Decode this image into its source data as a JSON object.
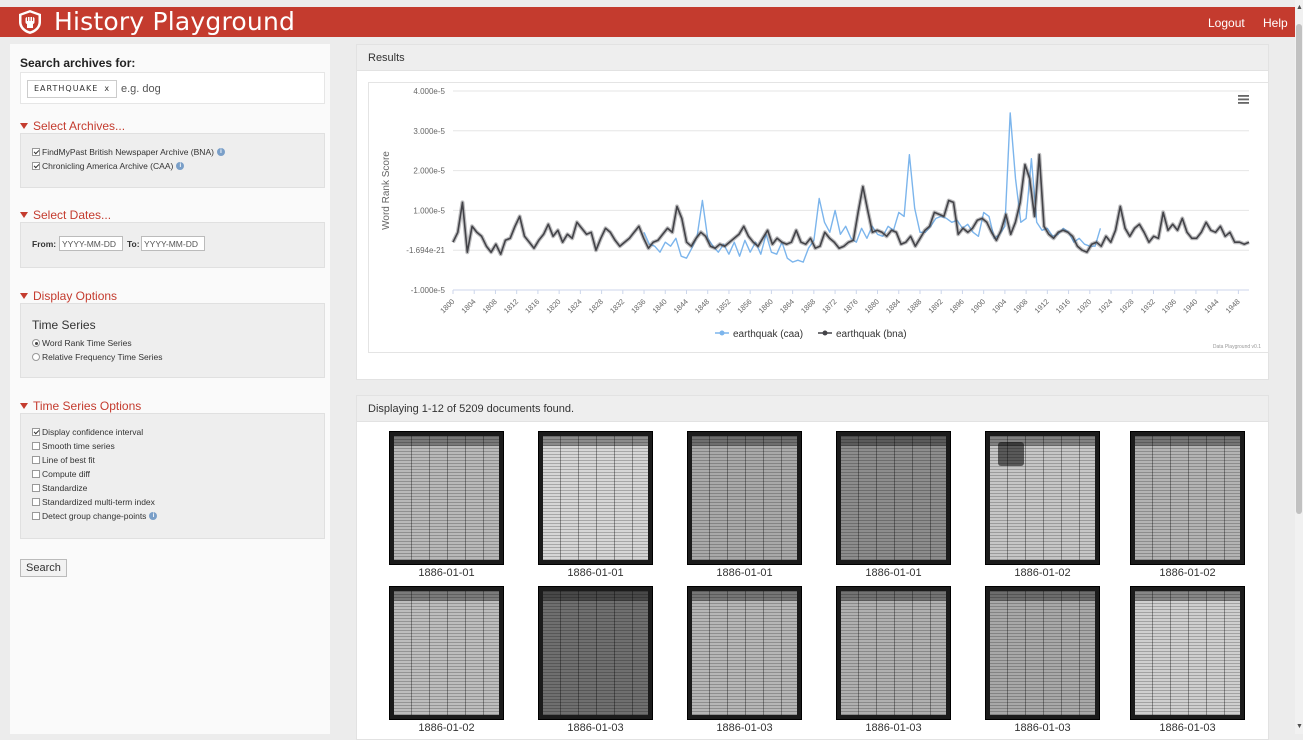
{
  "header": {
    "title": "History Playground",
    "logout_label": "Logout",
    "help_label": "Help",
    "brand_color": "#c43b2e",
    "logo_icon": "fist-shield-icon"
  },
  "sidebar": {
    "search_label": "Search archives for:",
    "search_term": "EARTHQUAKE",
    "search_term_remove": "x",
    "search_placeholder": "e.g. dog",
    "archives": {
      "title": "Select Archives...",
      "items": [
        {
          "label": "FindMyPast British Newspaper Archive (BNA)",
          "checked": true,
          "info_icon": "info-icon"
        },
        {
          "label": "Chronicling America Archive (CAA)",
          "checked": true,
          "info_icon": "info-icon"
        }
      ]
    },
    "dates": {
      "title": "Select Dates...",
      "from_label": "From:",
      "from_placeholder": "YYYY-MM-DD",
      "to_label": "To:",
      "to_placeholder": "YYYY-MM-DD"
    },
    "display": {
      "title": "Display Options",
      "subheading": "Time Series",
      "options": [
        {
          "label": "Word Rank Time Series",
          "selected": true
        },
        {
          "label": "Relative Frequency Time Series",
          "selected": false
        }
      ]
    },
    "ts_options": {
      "title": "Time Series Options",
      "items": [
        {
          "label": "Display confidence interval",
          "checked": true
        },
        {
          "label": "Smooth time series",
          "checked": false
        },
        {
          "label": "Line of best fit",
          "checked": false
        },
        {
          "label": "Compute diff",
          "checked": false
        },
        {
          "label": "Standardize",
          "checked": false
        },
        {
          "label": "Standardized multi-term index",
          "checked": false
        },
        {
          "label": "Detect group change-points",
          "checked": false,
          "info_icon": "info-icon"
        }
      ]
    },
    "search_button": "Search"
  },
  "results": {
    "title": "Results",
    "credit": "Data Playground v0.1",
    "menu_icon": "hamburger-menu-icon"
  },
  "chart_data": {
    "type": "line",
    "ylabel": "Word Rank Score",
    "xlabel": "",
    "ylim": [
      -1e-05,
      4e-05
    ],
    "y_ticks": [
      "-1.000e-5",
      "-1.694e-21",
      "1.000e-5",
      "2.000e-5",
      "3.000e-5",
      "4.000e-5"
    ],
    "x_ticks": [
      "1800",
      "1804",
      "1808",
      "1812",
      "1816",
      "1820",
      "1824",
      "1828",
      "1832",
      "1836",
      "1840",
      "1844",
      "1848",
      "1852",
      "1856",
      "1860",
      "1864",
      "1868",
      "1872",
      "1876",
      "1880",
      "1884",
      "1888",
      "1892",
      "1896",
      "1900",
      "1904",
      "1908",
      "1912",
      "1916",
      "1920",
      "1924",
      "1928",
      "1932",
      "1936",
      "1940",
      "1944",
      "1948"
    ],
    "x_start": 1800,
    "x_end": 1950,
    "series": [
      {
        "name": "earthquak (caa)",
        "color": "#7cb5ec",
        "x_start": 1836,
        "x_end": 1922,
        "values": [
          0.45,
          0.15,
          0.1,
          -0.05,
          0.2,
          0.1,
          0.3,
          -0.15,
          -0.2,
          0.05,
          0.35,
          1.25,
          0.3,
          0.1,
          -0.05,
          0.15,
          -0.1,
          0.2,
          -0.15,
          0.25,
          -0.05,
          0.2,
          -0.1,
          0.4,
          -0.05,
          -0.1,
          0.2,
          -0.2,
          -0.3,
          -0.25,
          -0.3,
          0.05,
          0.25,
          1.3,
          0.7,
          0.45,
          1.0,
          0.4,
          0.6,
          0.3,
          0.2,
          0.55,
          0.3,
          0.6,
          0.4,
          0.35,
          0.6,
          0.5,
          0.95,
          0.85,
          2.4,
          1.05,
          0.45,
          0.45,
          0.6,
          0.8,
          0.85,
          0.8,
          0.7,
          0.75,
          0.55,
          0.65,
          0.45,
          0.35,
          0.95,
          0.85,
          0.3,
          0.4,
          0.6,
          3.45,
          1.8,
          0.7,
          0.8,
          2.3,
          0.7,
          0.5,
          0.55,
          0.35,
          0.4,
          0.55,
          0.45,
          0.2,
          0.3,
          0.15,
          0.1,
          0.1,
          0.55
        ]
      },
      {
        "name": "earthquak (bna)",
        "color": "#434348",
        "x_start": 1800,
        "x_end": 1950,
        "values": [
          0.2,
          0.45,
          1.2,
          -0.05,
          0.6,
          0.45,
          0.35,
          0.1,
          -0.05,
          0.15,
          -0.1,
          0.25,
          0.3,
          0.6,
          0.85,
          0.35,
          0.2,
          0.05,
          0.25,
          0.4,
          0.65,
          0.35,
          0.5,
          0.2,
          0.4,
          0.3,
          0.7,
          0.55,
          0.4,
          0.45,
          0.0,
          0.3,
          0.55,
          0.45,
          0.25,
          0.1,
          0.2,
          0.3,
          0.45,
          0.6,
          0.3,
          0.05,
          0.2,
          0.25,
          0.4,
          0.55,
          0.45,
          1.1,
          0.8,
          0.2,
          0.1,
          0.3,
          0.45,
          0.35,
          0.1,
          0.05,
          0.15,
          0.1,
          0.2,
          0.3,
          0.4,
          0.6,
          0.35,
          0.2,
          0.1,
          0.3,
          0.5,
          0.15,
          0.3,
          0.2,
          0.15,
          0.2,
          0.5,
          0.2,
          0.15,
          0.3,
          0.05,
          0.1,
          0.45,
          0.3,
          0.2,
          0.05,
          0.1,
          0.2,
          0.25,
          0.95,
          1.6,
          1.0,
          0.45,
          0.5,
          0.45,
          0.35,
          0.5,
          0.45,
          0.15,
          0.2,
          0.35,
          0.1,
          0.3,
          0.5,
          0.6,
          0.95,
          0.9,
          0.85,
          1.25,
          1.2,
          0.4,
          0.55,
          0.45,
          0.55,
          0.75,
          0.8,
          0.7,
          0.45,
          0.25,
          0.5,
          0.9,
          0.4,
          0.7,
          1.2,
          2.15,
          1.8,
          0.85,
          2.4,
          0.6,
          0.4,
          0.3,
          0.45,
          0.5,
          0.45,
          0.35,
          0.1,
          0.0,
          -0.05,
          0.15,
          0.2,
          0.1,
          0.35,
          0.2,
          0.5,
          1.1,
          0.55,
          0.35,
          0.55,
          0.65,
          0.45,
          0.2,
          0.35,
          0.3,
          0.95,
          0.5,
          0.65,
          0.5,
          0.8,
          0.45,
          0.3,
          0.3,
          0.45,
          0.7,
          0.5,
          0.45,
          0.6,
          0.35,
          0.45,
          0.2,
          0.2,
          0.15,
          0.2
        ]
      }
    ],
    "value_scale": "1e-5",
    "legend_placement": "bottom-center",
    "grid": true
  },
  "documents": {
    "summary": "Displaying 1-12 of 5209 documents found.",
    "items": [
      {
        "date": "1886-01-01"
      },
      {
        "date": "1886-01-01"
      },
      {
        "date": "1886-01-01"
      },
      {
        "date": "1886-01-01"
      },
      {
        "date": "1886-01-02"
      },
      {
        "date": "1886-01-02"
      },
      {
        "date": "1886-01-02"
      },
      {
        "date": "1886-01-03"
      },
      {
        "date": "1886-01-03"
      },
      {
        "date": "1886-01-03"
      },
      {
        "date": "1886-01-03"
      },
      {
        "date": "1886-01-03"
      }
    ]
  }
}
